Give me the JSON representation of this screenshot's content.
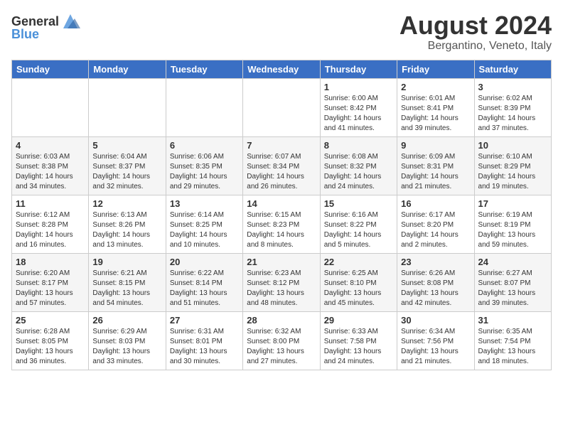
{
  "header": {
    "logo_general": "General",
    "logo_blue": "Blue",
    "month_year": "August 2024",
    "location": "Bergantino, Veneto, Italy"
  },
  "weekdays": [
    "Sunday",
    "Monday",
    "Tuesday",
    "Wednesday",
    "Thursday",
    "Friday",
    "Saturday"
  ],
  "weeks": [
    [
      {
        "day": "",
        "info": ""
      },
      {
        "day": "",
        "info": ""
      },
      {
        "day": "",
        "info": ""
      },
      {
        "day": "",
        "info": ""
      },
      {
        "day": "1",
        "info": "Sunrise: 6:00 AM\nSunset: 8:42 PM\nDaylight: 14 hours\nand 41 minutes."
      },
      {
        "day": "2",
        "info": "Sunrise: 6:01 AM\nSunset: 8:41 PM\nDaylight: 14 hours\nand 39 minutes."
      },
      {
        "day": "3",
        "info": "Sunrise: 6:02 AM\nSunset: 8:39 PM\nDaylight: 14 hours\nand 37 minutes."
      }
    ],
    [
      {
        "day": "4",
        "info": "Sunrise: 6:03 AM\nSunset: 8:38 PM\nDaylight: 14 hours\nand 34 minutes."
      },
      {
        "day": "5",
        "info": "Sunrise: 6:04 AM\nSunset: 8:37 PM\nDaylight: 14 hours\nand 32 minutes."
      },
      {
        "day": "6",
        "info": "Sunrise: 6:06 AM\nSunset: 8:35 PM\nDaylight: 14 hours\nand 29 minutes."
      },
      {
        "day": "7",
        "info": "Sunrise: 6:07 AM\nSunset: 8:34 PM\nDaylight: 14 hours\nand 26 minutes."
      },
      {
        "day": "8",
        "info": "Sunrise: 6:08 AM\nSunset: 8:32 PM\nDaylight: 14 hours\nand 24 minutes."
      },
      {
        "day": "9",
        "info": "Sunrise: 6:09 AM\nSunset: 8:31 PM\nDaylight: 14 hours\nand 21 minutes."
      },
      {
        "day": "10",
        "info": "Sunrise: 6:10 AM\nSunset: 8:29 PM\nDaylight: 14 hours\nand 19 minutes."
      }
    ],
    [
      {
        "day": "11",
        "info": "Sunrise: 6:12 AM\nSunset: 8:28 PM\nDaylight: 14 hours\nand 16 minutes."
      },
      {
        "day": "12",
        "info": "Sunrise: 6:13 AM\nSunset: 8:26 PM\nDaylight: 14 hours\nand 13 minutes."
      },
      {
        "day": "13",
        "info": "Sunrise: 6:14 AM\nSunset: 8:25 PM\nDaylight: 14 hours\nand 10 minutes."
      },
      {
        "day": "14",
        "info": "Sunrise: 6:15 AM\nSunset: 8:23 PM\nDaylight: 14 hours\nand 8 minutes."
      },
      {
        "day": "15",
        "info": "Sunrise: 6:16 AM\nSunset: 8:22 PM\nDaylight: 14 hours\nand 5 minutes."
      },
      {
        "day": "16",
        "info": "Sunrise: 6:17 AM\nSunset: 8:20 PM\nDaylight: 14 hours\nand 2 minutes."
      },
      {
        "day": "17",
        "info": "Sunrise: 6:19 AM\nSunset: 8:19 PM\nDaylight: 13 hours\nand 59 minutes."
      }
    ],
    [
      {
        "day": "18",
        "info": "Sunrise: 6:20 AM\nSunset: 8:17 PM\nDaylight: 13 hours\nand 57 minutes."
      },
      {
        "day": "19",
        "info": "Sunrise: 6:21 AM\nSunset: 8:15 PM\nDaylight: 13 hours\nand 54 minutes."
      },
      {
        "day": "20",
        "info": "Sunrise: 6:22 AM\nSunset: 8:14 PM\nDaylight: 13 hours\nand 51 minutes."
      },
      {
        "day": "21",
        "info": "Sunrise: 6:23 AM\nSunset: 8:12 PM\nDaylight: 13 hours\nand 48 minutes."
      },
      {
        "day": "22",
        "info": "Sunrise: 6:25 AM\nSunset: 8:10 PM\nDaylight: 13 hours\nand 45 minutes."
      },
      {
        "day": "23",
        "info": "Sunrise: 6:26 AM\nSunset: 8:08 PM\nDaylight: 13 hours\nand 42 minutes."
      },
      {
        "day": "24",
        "info": "Sunrise: 6:27 AM\nSunset: 8:07 PM\nDaylight: 13 hours\nand 39 minutes."
      }
    ],
    [
      {
        "day": "25",
        "info": "Sunrise: 6:28 AM\nSunset: 8:05 PM\nDaylight: 13 hours\nand 36 minutes."
      },
      {
        "day": "26",
        "info": "Sunrise: 6:29 AM\nSunset: 8:03 PM\nDaylight: 13 hours\nand 33 minutes."
      },
      {
        "day": "27",
        "info": "Sunrise: 6:31 AM\nSunset: 8:01 PM\nDaylight: 13 hours\nand 30 minutes."
      },
      {
        "day": "28",
        "info": "Sunrise: 6:32 AM\nSunset: 8:00 PM\nDaylight: 13 hours\nand 27 minutes."
      },
      {
        "day": "29",
        "info": "Sunrise: 6:33 AM\nSunset: 7:58 PM\nDaylight: 13 hours\nand 24 minutes."
      },
      {
        "day": "30",
        "info": "Sunrise: 6:34 AM\nSunset: 7:56 PM\nDaylight: 13 hours\nand 21 minutes."
      },
      {
        "day": "31",
        "info": "Sunrise: 6:35 AM\nSunset: 7:54 PM\nDaylight: 13 hours\nand 18 minutes."
      }
    ]
  ]
}
